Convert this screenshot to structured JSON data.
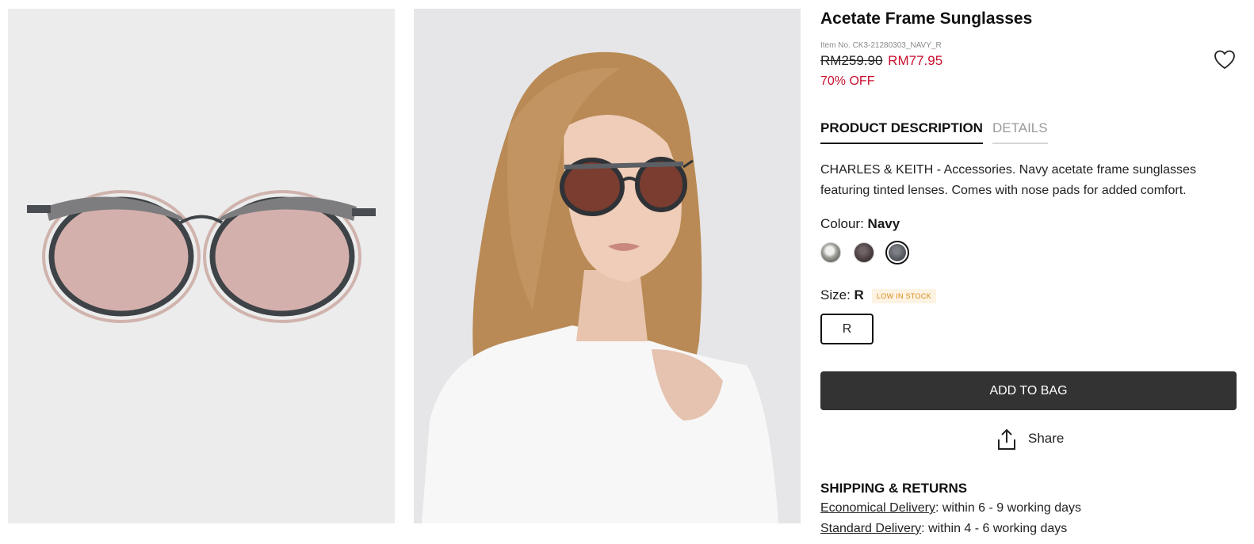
{
  "product": {
    "title": "Acetate Frame Sunglasses",
    "item_no": "Item No. CK3-21280303_NAVY_R",
    "original_price": "RM259.90",
    "sale_price": "RM77.95",
    "discount": "70% OFF",
    "wishlist_icon": "heart-icon"
  },
  "tabs": [
    {
      "label": "PRODUCT DESCRIPTION",
      "active": true
    },
    {
      "label": "DETAILS",
      "active": false
    }
  ],
  "description": "CHARLES & KEITH - Accessories. Navy acetate frame sunglasses featuring tinted lenses. Comes with nose pads for added comfort.",
  "colour": {
    "label": "Colour:",
    "selected": "Navy",
    "swatches": [
      {
        "color": "#8e8e88"
      },
      {
        "color": "#463c3d"
      },
      {
        "color": "#55585e",
        "selected": true
      }
    ]
  },
  "size": {
    "label": "Size:",
    "selected": "R",
    "stock_badge": "LOW IN STOCK",
    "options": [
      "R"
    ]
  },
  "actions": {
    "add_to_bag": "ADD TO BAG",
    "share": "Share",
    "share_icon": "share-upload-icon"
  },
  "shipping": {
    "title": "SHIPPING & RETURNS",
    "lines": [
      {
        "link": "Economical Delivery",
        "text": ": within 6 - 9 working days"
      },
      {
        "link": "Standard Delivery",
        "text": ": within 4 - 6 working days"
      }
    ]
  },
  "colors": {
    "sale": "#c8102e",
    "button_bg": "#333333",
    "low_stock": "#d88a1a"
  }
}
